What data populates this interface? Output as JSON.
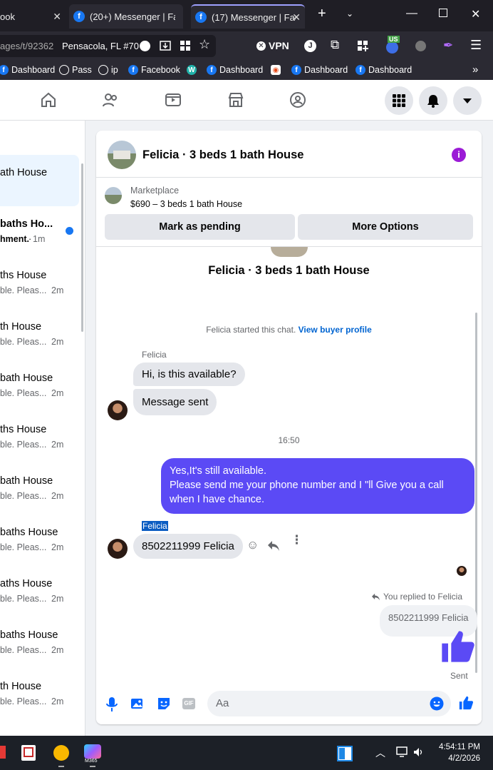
{
  "browser": {
    "tabs": [
      {
        "label": "ook"
      },
      {
        "label": "(20+) Messenger | Fac"
      },
      {
        "label": "(17) Messenger | Face"
      }
    ],
    "url": "ages/t/92362",
    "location": "Pensacola, FL #70",
    "vpn_label": "VPN",
    "profile_initial": "J",
    "us_badge": "US",
    "bookmarks": [
      "Dashboard",
      "Pass",
      "ip",
      "Facebook",
      "Dashboard",
      "Dashboard",
      "Dashboard"
    ]
  },
  "conversations": [
    {
      "title": "ath House",
      "sub": "",
      "time": ""
    },
    {
      "title": "baths Ho...",
      "sub": "hment.",
      "time": "1m"
    },
    {
      "title": "ths House",
      "sub": "ble. Pleas...",
      "time": "2m"
    },
    {
      "title": "th House",
      "sub": "ble. Pleas...",
      "time": "2m"
    },
    {
      "title": "bath House",
      "sub": "ble. Pleas...",
      "time": "2m"
    },
    {
      "title": "ths House",
      "sub": "ble. Pleas...",
      "time": "2m"
    },
    {
      "title": "bath House",
      "sub": "ble. Pleas...",
      "time": "2m"
    },
    {
      "title": "baths House",
      "sub": "ble. Pleas...",
      "time": "2m"
    },
    {
      "title": "aths House",
      "sub": "ble. Pleas...",
      "time": "2m"
    },
    {
      "title": "baths House",
      "sub": "ble. Pleas...",
      "time": "2m"
    },
    {
      "title": "th House",
      "sub": "ble. Pleas...",
      "time": "2m"
    }
  ],
  "chat": {
    "header_title": "Felicia · 3 beds 1 bath House",
    "marketplace_label": "Marketplace",
    "listing": "$690 – 3 beds 1 bath House",
    "mark_pending": "Mark as pending",
    "more_options": "More Options",
    "profile_title": "Felicia · 3 beds 1 bath House",
    "started_text": "Felicia started this chat.",
    "view_buyer_profile": "View buyer profile",
    "sender_name": "Felicia",
    "msg1": "Hi, is this available?",
    "msg2": "Message sent",
    "timestamp": "16:50",
    "reply_line1": "Yes,It's still available.",
    "reply_line2": "Please send me your phone number and I \"ll Give you a call when I have chance.",
    "sender_name2": "Felicia",
    "msg3": "8502211999 Felicia",
    "replied_to": "You replied to Felicia",
    "quoted": "8502211999 Felicia",
    "sent_label": "Sent",
    "composer_placeholder": "Aa",
    "gif_label": "GIF"
  },
  "taskbar": {
    "time": "4:54:11 PM",
    "date": "4/2/2026",
    "m365_label": "M365"
  },
  "colors": {
    "accent": "#5b4af5",
    "fb_blue": "#1877f2",
    "link": "#0064d1"
  }
}
